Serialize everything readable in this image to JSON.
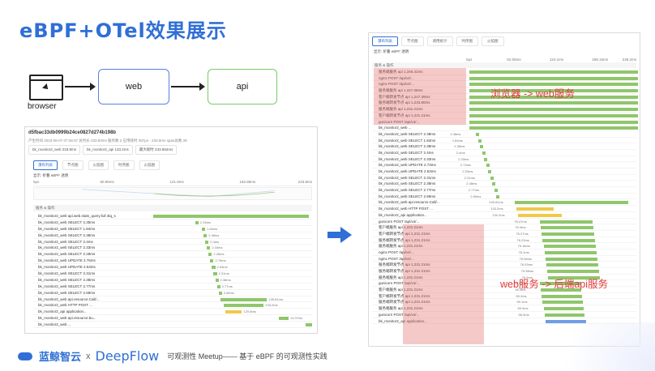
{
  "slide": {
    "title": "eBPF+OTel效果展示"
  },
  "diagram": {
    "browser_label": "browser",
    "web_label": "web",
    "api_label": "api"
  },
  "left_screenshot": {
    "trace_id": "d5fbac33db0999b24ce0827d274b198b",
    "meta": "产生时间 2023-06-07 07:28:37   总时长 233.83ms   服务数 2   应用耗时 287μs - 233.8ms   span总数 28",
    "cards": [
      "bk_monitor2_web 233.8ms",
      "bk_monitor2_api 133.2ms",
      "最大耗时 233.862ms"
    ],
    "subtabs": [
      "瀑布列表",
      "节点图",
      "火焰图",
      "时序图",
      "火焰图"
    ],
    "options": "显示: 折叠  eBPF  透明",
    "axis": [
      "0μs",
      "60.95ms",
      "121.9ms",
      "182.85ms",
      "233.8ms"
    ],
    "header": "服务 & 操作",
    "rows": [
      {
        "name": "bk_monitor2_web  api.web.stats_query.full 4tq_s",
        "val": "",
        "bar": "g"
      },
      {
        "name": "bk_monitor2_web  SELECT 2.35ms",
        "val": "2.35ms",
        "bar": "g"
      },
      {
        "name": "bk_monitor2_web  SELECT 1.84ms",
        "val": "1.84ms",
        "bar": "g"
      },
      {
        "name": "bk_monitor2_web  SELECT 2.38ms",
        "val": "2.38ms",
        "bar": "g"
      },
      {
        "name": "bk_monitor2_web  SELECT 2.4ms",
        "val": "2.4ms",
        "bar": "g"
      },
      {
        "name": "bk_monitor2_web  SELECT 2.33ms",
        "val": "2.33ms",
        "bar": "g"
      },
      {
        "name": "bk_monitor2_web  SELECT 2.28ms",
        "val": "2.28ms",
        "bar": "g"
      },
      {
        "name": "bk_monitor2_web  UPDATE 2.76ms",
        "val": "2.76ms",
        "bar": "g"
      },
      {
        "name": "bk_monitor2_web  UPDATE 2.53ms",
        "val": "2.53ms",
        "bar": "g"
      },
      {
        "name": "bk_monitor2_web  SELECT 2.31ms",
        "val": "2.31ms",
        "bar": "g"
      },
      {
        "name": "bk_monitor2_web  SELECT 2.38ms",
        "val": "2.38ms",
        "bar": "g"
      },
      {
        "name": "bk_monitor2_web  SELECT 2.77ms",
        "val": "2.77ms",
        "bar": "g"
      },
      {
        "name": "bk_monitor2_web  SELECT 2.69ms",
        "val": "2.69ms",
        "bar": "g"
      },
      {
        "name": "bk_monitor2_web  api.resource.Call/...",
        "val": "135.81ms",
        "bar": "g"
      },
      {
        "name": "bk_monitor2_web  HTTP POST ...",
        "val": "133.2ms",
        "bar": "g"
      },
      {
        "name": "bk_monitor2_api  application...",
        "val": "129.8ms",
        "bar": "y"
      },
      {
        "name": "bk_monitor2_web  api.resource.bu...",
        "val": "11.07ms",
        "bar": "g"
      },
      {
        "name": "bk_monitor2_web  ...",
        "val": "",
        "bar": "g"
      }
    ]
  },
  "right_screenshot": {
    "tabs": [
      "瀑布列表",
      "节点图",
      "调用统计",
      "时序图",
      "火焰图"
    ],
    "options": "显示: 折叠  eBPF  透明",
    "axis": [
      "0μs",
      "62.05ms",
      "124.1ms",
      "186.15ms",
      "248.2ms"
    ],
    "header": "服务 & 操作",
    "rows": [
      {
        "name": "服务端服务  api 1,346.31ms",
        "val": "",
        "bar": "g"
      },
      {
        "name": "nginx  POST /api/v4/...",
        "val": "",
        "bar": "g"
      },
      {
        "name": "nginx  POST /api/v4/...",
        "val": "",
        "bar": "g"
      },
      {
        "name": "服务端服务  api 1,347.09ms",
        "val": "",
        "bar": "g"
      },
      {
        "name": "客户端转发节点  api 1,247.39ms",
        "val": "",
        "bar": "g"
      },
      {
        "name": "服务端转发节点  api 1,233.80ms",
        "val": "",
        "bar": "g"
      },
      {
        "name": "服务端服务  api 1,231.21ms",
        "val": "",
        "bar": "g"
      },
      {
        "name": "客户端转发节点  api 1,231.21ms",
        "val": "",
        "bar": "g"
      },
      {
        "name": "gunicorn  POST /api/v4/...",
        "val": "",
        "bar": "g"
      },
      {
        "name": "bk_monitor2_web  ...",
        "val": "",
        "bar": "g"
      },
      {
        "name": "bk_monitor2_web  SELECT 2.38ms",
        "val": "2.38ms",
        "bar": "g"
      },
      {
        "name": "bk_monitor2_web  SELECT 1.84ms",
        "val": "1.84ms",
        "bar": "g"
      },
      {
        "name": "bk_monitor2_web  SELECT 2.38ms",
        "val": "2.38ms",
        "bar": "g"
      },
      {
        "name": "bk_monitor2_web  SELECT 2.4ms",
        "val": "2.4ms",
        "bar": "g"
      },
      {
        "name": "bk_monitor2_web  SELECT 2.33ms",
        "val": "2.33ms",
        "bar": "g"
      },
      {
        "name": "bk_monitor2_web  UPDATE 2.73ms",
        "val": "2.73ms",
        "bar": "g"
      },
      {
        "name": "bk_monitor2_web  UPDATE 2.53ms",
        "val": "2.53ms",
        "bar": "g"
      },
      {
        "name": "bk_monitor2_web  SELECT 2.31ms",
        "val": "2.31ms",
        "bar": "g"
      },
      {
        "name": "bk_monitor2_web  SELECT 2.38ms",
        "val": "2.38ms",
        "bar": "g"
      },
      {
        "name": "bk_monitor2_web  SELECT 2.77ms",
        "val": "2.77ms",
        "bar": "g"
      },
      {
        "name": "bk_monitor2_web  SELECT 2.69ms",
        "val": "2.69ms",
        "bar": "g"
      },
      {
        "name": "bk_monitor2_web  api.resource.Call/...",
        "val": "135.81ms",
        "bar": "g"
      },
      {
        "name": "bk_monitor2_web  HTTP POST ...",
        "val": "133.2ms",
        "bar": "y"
      },
      {
        "name": "bk_monitor2_api  application...",
        "val": "130.2ms",
        "bar": "y"
      },
      {
        "name": "gunicorn  POST /api/v4/...",
        "val": "76.47ms",
        "bar": "g"
      },
      {
        "name": "客户端服务  api 1,231.21ms",
        "val": "76.3ms",
        "bar": "g"
      },
      {
        "name": "客户端转发节点  api 1,231.21ms",
        "val": "76.27ms",
        "bar": "g"
      },
      {
        "name": "服务端转发节点  api 1,231.21ms",
        "val": "76.23ms",
        "bar": "g"
      },
      {
        "name": "服务端服务  api 1,231.21ms",
        "val": "76.18ms",
        "bar": "g"
      },
      {
        "name": "nginx  POST /api/v4/...",
        "val": "76.1ms",
        "bar": "g"
      },
      {
        "name": "nginx  POST /api/v4/...",
        "val": "76.08ms",
        "bar": "g"
      },
      {
        "name": "服务端转发节点  api 1,231.21ms",
        "val": "76.03ms",
        "bar": "g"
      },
      {
        "name": "服务端转发节点  api 1,231.21ms",
        "val": "75.98ms",
        "bar": "g"
      },
      {
        "name": "服务端服务  api 1,231.21ms",
        "val": "75.9ms",
        "bar": "g"
      },
      {
        "name": "gunicorn  POST /api/v4/...",
        "val": "59.39ms",
        "bar": "g"
      },
      {
        "name": "客户端服务  api 1,231.21ms",
        "val": "59.3ms",
        "bar": "g"
      },
      {
        "name": "客户端转发节点  api 1,231.21ms",
        "val": "59.2ms",
        "bar": "g"
      },
      {
        "name": "服务端转发节点  api 1,231.21ms",
        "val": "59.1ms",
        "bar": "g"
      },
      {
        "name": "服务端服务  api 1,231.21ms",
        "val": "59.0ms",
        "bar": "g"
      },
      {
        "name": "gunicorn  POST /api/v4/...",
        "val": "58.9ms",
        "bar": "g"
      },
      {
        "name": "bk_monitor2_api  application...",
        "val": "",
        "bar": "b"
      }
    ],
    "annotation_1": "浏览器 -> web服务",
    "annotation_2": "web服务 -> 后端api服务"
  },
  "footer": {
    "logo1": "蓝鲸智云",
    "x": "x",
    "logo2": "DeepFlow",
    "subtitle": "可观测性 Meetup—— 基于 eBPF 的可观测性实践"
  },
  "colors": {
    "accent": "#2f6fd6",
    "highlight": "#e77070",
    "bar_green": "#8fc66b",
    "bar_yellow": "#f0c94b"
  }
}
